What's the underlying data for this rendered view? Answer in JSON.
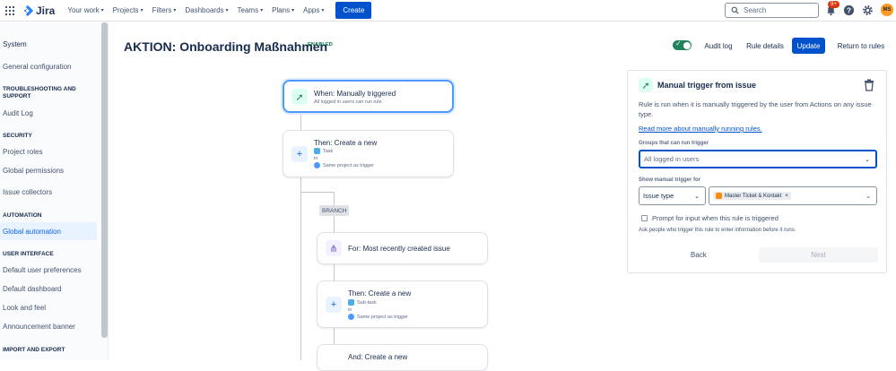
{
  "app": {
    "name": "Jira"
  },
  "topnav": {
    "items": [
      "Your work",
      "Projects",
      "Filters",
      "Dashboards",
      "Teams",
      "Plans",
      "Apps"
    ],
    "create_label": "Create",
    "search_placeholder": "Search",
    "notification_count": "9+",
    "avatar_initials": "MS"
  },
  "sidebar": {
    "title": "System",
    "general_configuration": "General configuration",
    "sections": {
      "troubleshooting": "TROUBLESHOOTING AND SUPPORT",
      "security": "SECURITY",
      "automation": "AUTOMATION",
      "user_interface": "USER INTERFACE",
      "import_export": "IMPORT AND EXPORT"
    },
    "audit_log": "Audit Log",
    "project_roles": "Project roles",
    "global_permissions": "Global permissions",
    "issue_collectors": "Issue collectors",
    "global_automation": "Global automation",
    "default_user_preferences": "Default user preferences",
    "default_dashboard": "Default dashboard",
    "look_and_feel": "Look and feel",
    "announcement_banner": "Announcement banner"
  },
  "rule": {
    "title": "AKTION: Onboarding Maßnahmen",
    "status": "ENABLED",
    "audit_log": "Audit log",
    "rule_details": "Rule details",
    "update": "Update",
    "return": "Return to rules"
  },
  "canvas": {
    "trigger": {
      "title": "When: Manually triggered",
      "sub": "All logged in users can run rule."
    },
    "action1": {
      "title": "Then: Create a new",
      "type": "Task",
      "in": "in",
      "project": "Same project as trigger"
    },
    "branch_label": "BRANCH",
    "branch": {
      "title": "For: Most recently created issue"
    },
    "action2": {
      "title": "Then: Create a new",
      "type": "Sub-task",
      "in": "in",
      "project": "Same project as trigger"
    },
    "action3": {
      "title": "And: Create a new"
    }
  },
  "panel": {
    "title": "Manual trigger from issue",
    "description": "Rule is run when it is manually triggered by the user from Actions on any issue type.",
    "link": "Read more about manually running rules.",
    "groups_label": "Groups that can run trigger",
    "groups_value": "All logged in users",
    "show_label": "Show manual trigger for",
    "issue_type_value": "Issue type",
    "tag_value": "Master Ticket & Kontakt",
    "prompt_label": "Prompt for input when this rule is triggered",
    "prompt_help": "Ask people who trigger this rule to enter information before it runs.",
    "back": "Back",
    "next": "Next"
  },
  "colors": {
    "brand": "#0052cc",
    "enabled": "#006644",
    "toggle": "#1f845a",
    "trigger_icon_bg": "#dcfff1",
    "action_icon_bg": "#e9f2ff",
    "branch_icon_bg": "#f3f0ff"
  }
}
